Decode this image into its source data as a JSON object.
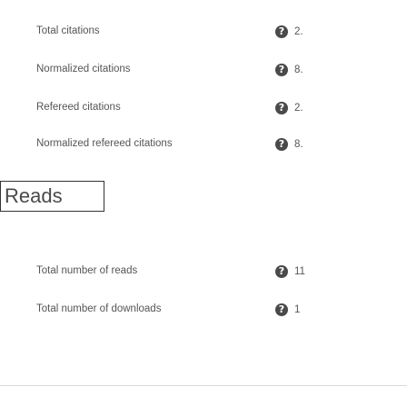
{
  "citations": {
    "rows": [
      {
        "label": "Total citations",
        "value": "2."
      },
      {
        "label": "Normalized citations",
        "value": "8."
      },
      {
        "label": "Refereed citations",
        "value": "2."
      },
      {
        "label": "Normalized refereed citations",
        "value": "8."
      }
    ]
  },
  "reads": {
    "title": "Reads",
    "rows": [
      {
        "label": "Total number of reads",
        "value": "11"
      },
      {
        "label": "Total number of downloads",
        "value": "1"
      }
    ]
  },
  "icons": {
    "help": "question-circle-icon",
    "help_glyph": "?"
  }
}
